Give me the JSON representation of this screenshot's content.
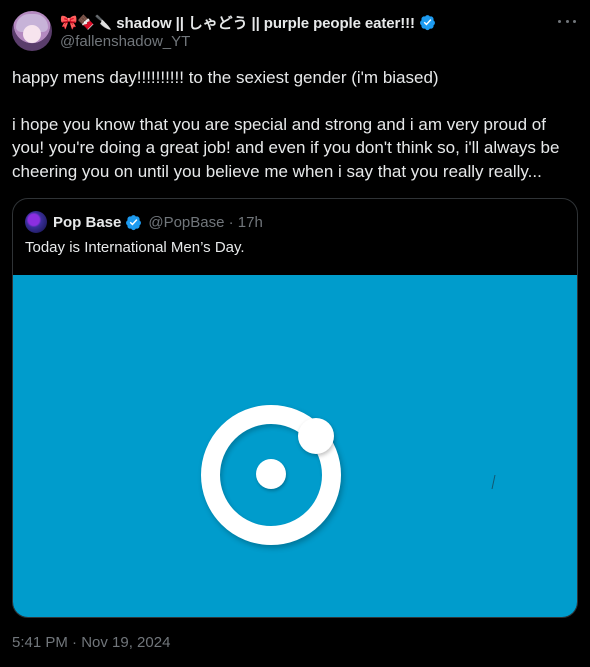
{
  "tweet": {
    "name_emojis": "🎀🍫🔪",
    "display_name": "shadow || しゃどう || purple people eater!!!",
    "handle": "@fallenshadow_YT",
    "paragraphs": [
      "happy mens day!!!!!!!!!! to the sexiest gender (i'm biased)",
      "i hope you know that you are special and strong and i am very proud of you! you're doing a great job! and even if you don't think so, i'll always be cheering you on until you believe me when i say that you really really..."
    ],
    "timestamp": "5:41 PM · Nov 19, 2024"
  },
  "quote": {
    "display_name": "Pop Base",
    "handle_time": "@PopBase · 17h",
    "text": "Today is International Men’s Day."
  },
  "colors": {
    "background": "#000000",
    "verified_blue": "#1d9bf0",
    "media_blue": "#009ccc",
    "muted_text": "#71767b"
  },
  "icons": [
    "more-icon",
    "verified-icon"
  ]
}
